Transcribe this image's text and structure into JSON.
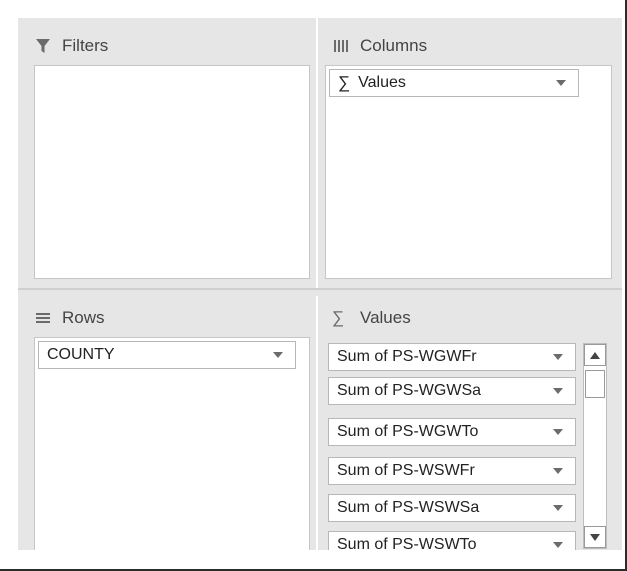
{
  "filters": {
    "title": "Filters",
    "icon": "filter-icon"
  },
  "columns": {
    "title": "Columns",
    "icon": "columns-icon",
    "items": [
      {
        "label": "Values",
        "icon": "sigma-icon"
      }
    ]
  },
  "rows": {
    "title": "Rows",
    "icon": "rows-icon",
    "items": [
      {
        "label": "COUNTY"
      }
    ]
  },
  "values": {
    "title": "Values",
    "icon": "sigma-icon",
    "items": [
      {
        "label": "Sum of PS-WGWFr"
      },
      {
        "label": "Sum of PS-WGWSa"
      },
      {
        "label": "Sum of PS-WGWTo"
      },
      {
        "label": "Sum of PS-WSWFr"
      },
      {
        "label": "Sum of PS-WSWSa"
      },
      {
        "label": "Sum of PS-WSWTo"
      }
    ]
  },
  "sigma_glyph": "∑",
  "colors": {
    "panel_bg": "#e6e6e6",
    "box_bg": "#ffffff",
    "text": "#222222",
    "header_text": "#444444"
  }
}
